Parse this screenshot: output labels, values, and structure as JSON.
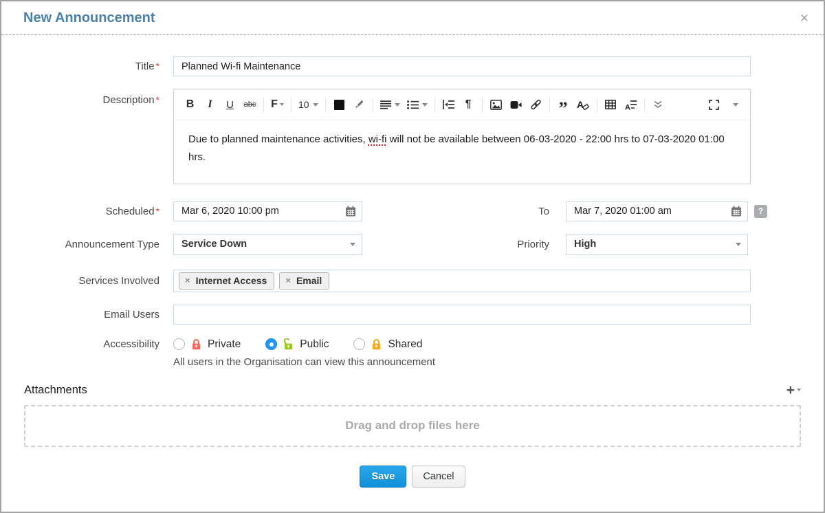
{
  "window": {
    "title": "New Announcement",
    "close_glyph": "×"
  },
  "form": {
    "title": {
      "label": "Title",
      "required_mark": "*",
      "value": "Planned Wi-fi Maintenance"
    },
    "description": {
      "label": "Description",
      "required_mark": "*",
      "toolbar": {
        "bold": "B",
        "italic": "I",
        "underline": "U",
        "strikethrough": "abc",
        "font_family": "F",
        "font_size": "10",
        "paragraph": "¶",
        "quote": "”"
      },
      "content": {
        "before": "Due to planned maintenance activities, ",
        "misspelled_word": "wi-fi",
        "after": " will not be available between 06-03-2020 - 22:00 hrs to 07-03-2020 01:00 hrs."
      }
    },
    "scheduled": {
      "label": "Scheduled",
      "required_mark": "*",
      "value": "Mar 6, 2020 10:00 pm"
    },
    "to": {
      "label": "To",
      "value": "Mar 7, 2020 01:00 am",
      "help_glyph": "?"
    },
    "announcement_type": {
      "label": "Announcement Type",
      "value": "Service Down"
    },
    "priority": {
      "label": "Priority",
      "value": "High"
    },
    "services_involved": {
      "label": "Services Involved",
      "tags": [
        {
          "remove_glyph": "×",
          "label": "Internet Access"
        },
        {
          "remove_glyph": "×",
          "label": "Email"
        }
      ]
    },
    "email_users": {
      "label": "Email Users",
      "value": "",
      "placeholder": ""
    },
    "accessibility": {
      "label": "Accessibility",
      "options": [
        {
          "label": "Private",
          "selected": false
        },
        {
          "label": "Public",
          "selected": true
        },
        {
          "label": "Shared",
          "selected": false
        }
      ],
      "helper_text": "All users in the Organisation can view this announcement"
    }
  },
  "attachments": {
    "label": "Attachments",
    "add_glyph": "+",
    "dropzone_text": "Drag and drop files here"
  },
  "footer": {
    "save_label": "Save",
    "cancel_label": "Cancel"
  },
  "colors": {
    "header_blue": "#4c80a8",
    "accent_blue": "#1a9ae0",
    "radio_selected": "#2196f3",
    "lock_private": "#f8695f",
    "lock_public": "#9dc41f",
    "lock_shared": "#f9a81b",
    "required_red": "#e53935"
  }
}
